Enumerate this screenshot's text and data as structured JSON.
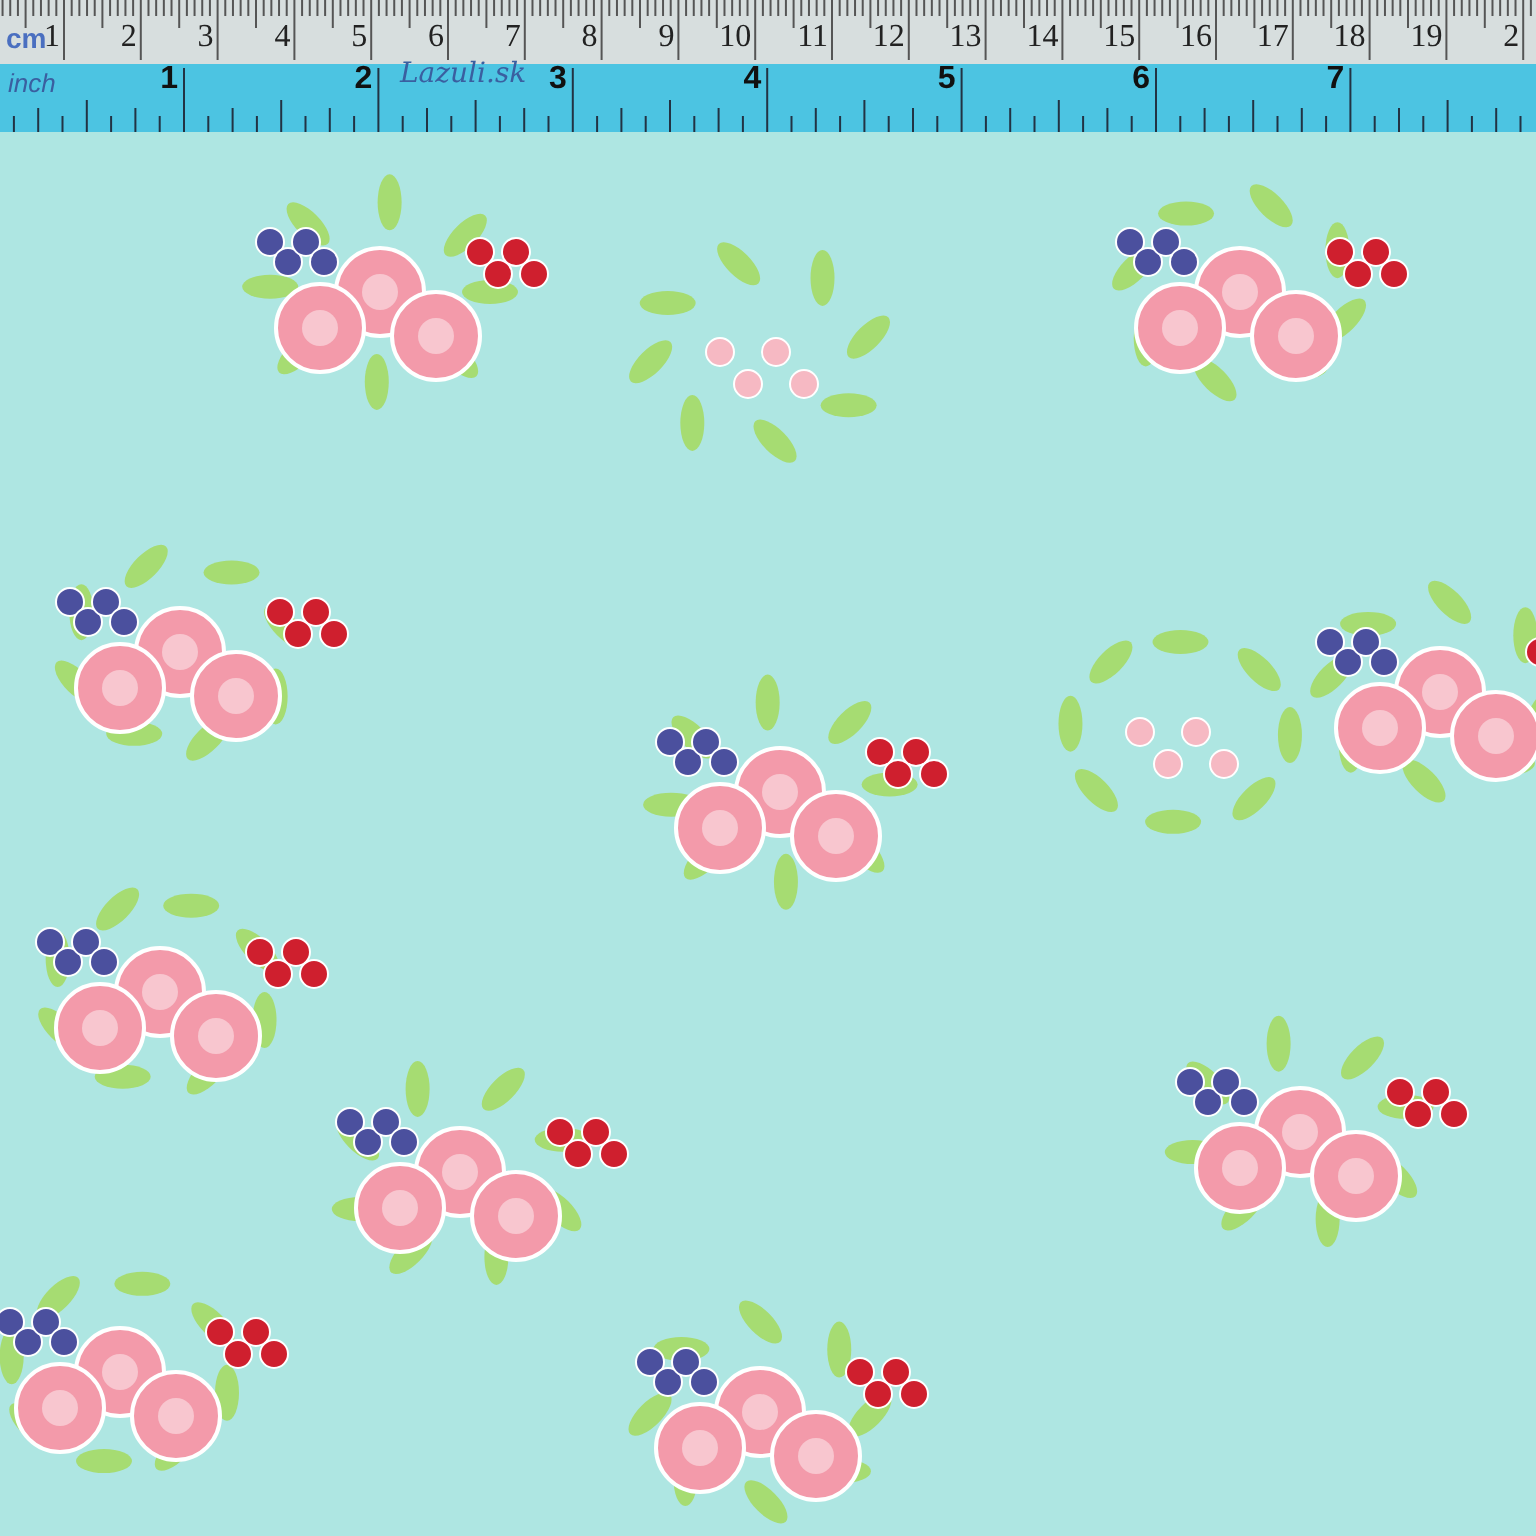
{
  "ruler": {
    "cm_unit": "cm",
    "cm_labels": [
      "1",
      "2",
      "3",
      "4",
      "5",
      "6",
      "7",
      "8",
      "9",
      "10",
      "11",
      "12",
      "13",
      "14",
      "15",
      "16",
      "17",
      "18",
      "19",
      "2"
    ],
    "inch_unit": "inch",
    "inch_labels": [
      "1",
      "2",
      "3",
      "4",
      "5",
      "6",
      "7"
    ],
    "handwriting": "Lazuli.sk"
  },
  "fabric": {
    "kind": "floral"
  }
}
